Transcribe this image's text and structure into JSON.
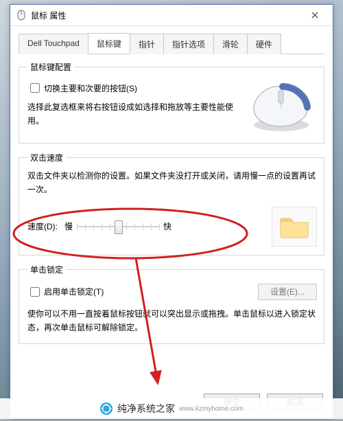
{
  "window": {
    "title": "鼠标 属性"
  },
  "tabs": [
    {
      "label": "Dell Touchpad"
    },
    {
      "label": "鼠标键"
    },
    {
      "label": "指针"
    },
    {
      "label": "指针选项"
    },
    {
      "label": "滑轮"
    },
    {
      "label": "硬件"
    }
  ],
  "active_tab_index": 1,
  "group_button": {
    "legend": "鼠标键配置",
    "swap_label": "切换主要和次要的按钮(S)",
    "swap_checked": false,
    "note": "选择此复选框来将右按钮设成如选择和拖放等主要性能使用。"
  },
  "group_dblclk": {
    "legend": "双击速度",
    "note": "双击文件夹以检测你的设置。如果文件夹没打开或关闭，请用慢一点的设置再试一次。",
    "speed_label": "速度(D):",
    "slow": "慢",
    "fast": "快",
    "slider": {
      "min": 0,
      "max": 10,
      "value": 5
    }
  },
  "group_clicklock": {
    "legend": "单击锁定",
    "enable_label": "启用单击锁定(T)",
    "enable_checked": false,
    "settings_button": "设置(E)...",
    "settings_enabled": false,
    "note": "使你可以不用一直按着鼠标按钮就可以突出显示或拖拽。单击鼠标以进入锁定状态，再次单击鼠标可解除锁定。"
  },
  "actions": {
    "ok": "确定",
    "cancel": "取消"
  },
  "watermark": {
    "name": "纯净系统之家",
    "domain": "www.kzmyhome.com"
  },
  "annotation": {
    "color": "#d21f1f"
  }
}
